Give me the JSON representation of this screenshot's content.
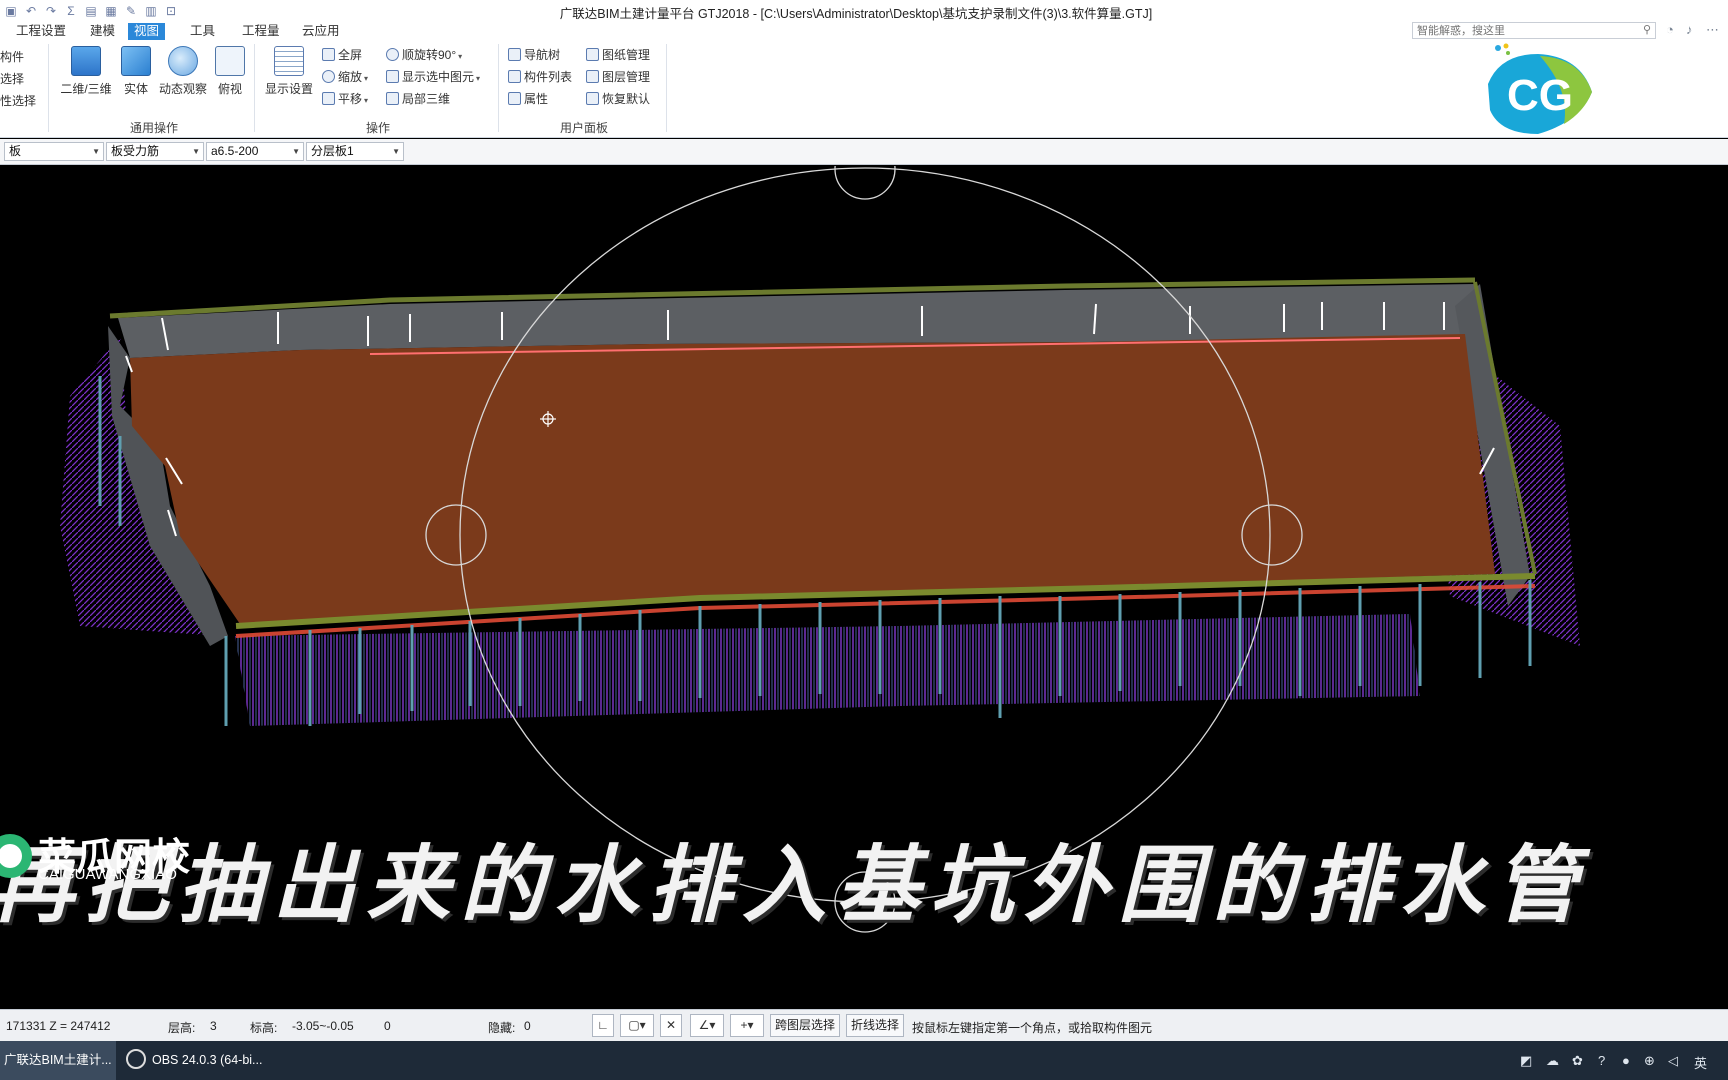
{
  "window": {
    "title": "广联达BIM土建计量平台 GTJ2018 - [C:\\Users\\Administrator\\Desktop\\基坑支护录制文件(3)\\3.软件算量.GTJ]"
  },
  "menu": [
    {
      "label": "工程设置"
    },
    {
      "label": "建模"
    },
    {
      "label": "视图"
    },
    {
      "label": "工具"
    },
    {
      "label": "工程量"
    },
    {
      "label": "云应用"
    }
  ],
  "search": {
    "placeholder": "智能解惑，搜这里"
  },
  "ribbon": {
    "left_stub": [
      "构件",
      "选择",
      "性选择"
    ],
    "general": {
      "buttons": [
        "二维/三维",
        "实体",
        "动态观察",
        "俯视"
      ],
      "label": "通用操作"
    },
    "operate": {
      "display_settings": "显示设置",
      "small": [
        "全屏",
        "缩放",
        "平移",
        "顺旋转90°",
        "显示选中图元",
        "局部三维"
      ],
      "label": "操作"
    },
    "user_panel": {
      "small": [
        "导航树",
        "构件列表",
        "属性",
        "图纸管理",
        "图层管理",
        "恢复默认"
      ],
      "label": "用户面板"
    }
  },
  "logo": {
    "text": "CG"
  },
  "selectors": [
    "板",
    "板受力筋",
    "a6.5-200",
    "分层板1"
  ],
  "overlay": {
    "subtitle": "再把抽出来的水排入基坑外围的排水管",
    "watermark_name": "菜瓜网校",
    "watermark_pinyin": "CAIGUAWANGXIAO"
  },
  "status": {
    "coords": "171331 Z = 247412",
    "floor_height_label": "层高:",
    "floor_height": "3",
    "elevation_label": "标高:",
    "elevation": "-3.05~-0.05",
    "zero": "0",
    "hidden_label": "隐藏:",
    "hidden": "0",
    "cross_layer": "跨图层选择",
    "polyline": "折线选择",
    "hint": "按鼠标左键指定第一个角点，或拾取构件图元"
  },
  "taskbar": {
    "items": [
      "广联达BIM土建计...",
      "OBS 24.0.3 (64-bi..."
    ],
    "lang": "英"
  },
  "colors": {
    "accent": "#2b88d9",
    "slab": "#7a3a1c",
    "anchor_violet": "#8a3bd8",
    "wall_grey": "#5b5e62"
  }
}
